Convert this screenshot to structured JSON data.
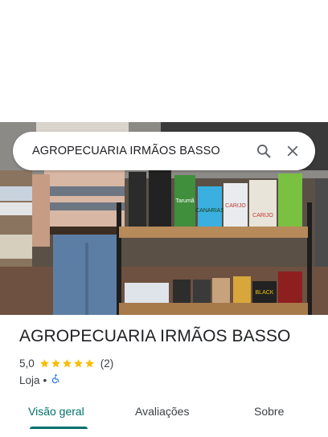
{
  "search": {
    "query": "AGROPECUARIA IRMÃOS BASSO"
  },
  "place": {
    "title": "AGROPECUARIA IRMÃOS BASSO",
    "rating": "5,0",
    "stars": 5,
    "review_count": "(2)",
    "category": "Loja",
    "separator": "•",
    "accessibility_icon": "wheelchair-icon"
  },
  "tabs": [
    {
      "label": "Visão geral",
      "active": true
    },
    {
      "label": "Avaliações",
      "active": false
    },
    {
      "label": "Sobre",
      "active": false
    }
  ],
  "photo": {
    "product_labels": [
      "Tarumã",
      "CANARIAS",
      "CARIJO",
      "CARIJO",
      "BLACK"
    ]
  },
  "colors": {
    "accent": "#01706d",
    "star": "#fbbc04",
    "accessibility": "#1a73e8"
  }
}
